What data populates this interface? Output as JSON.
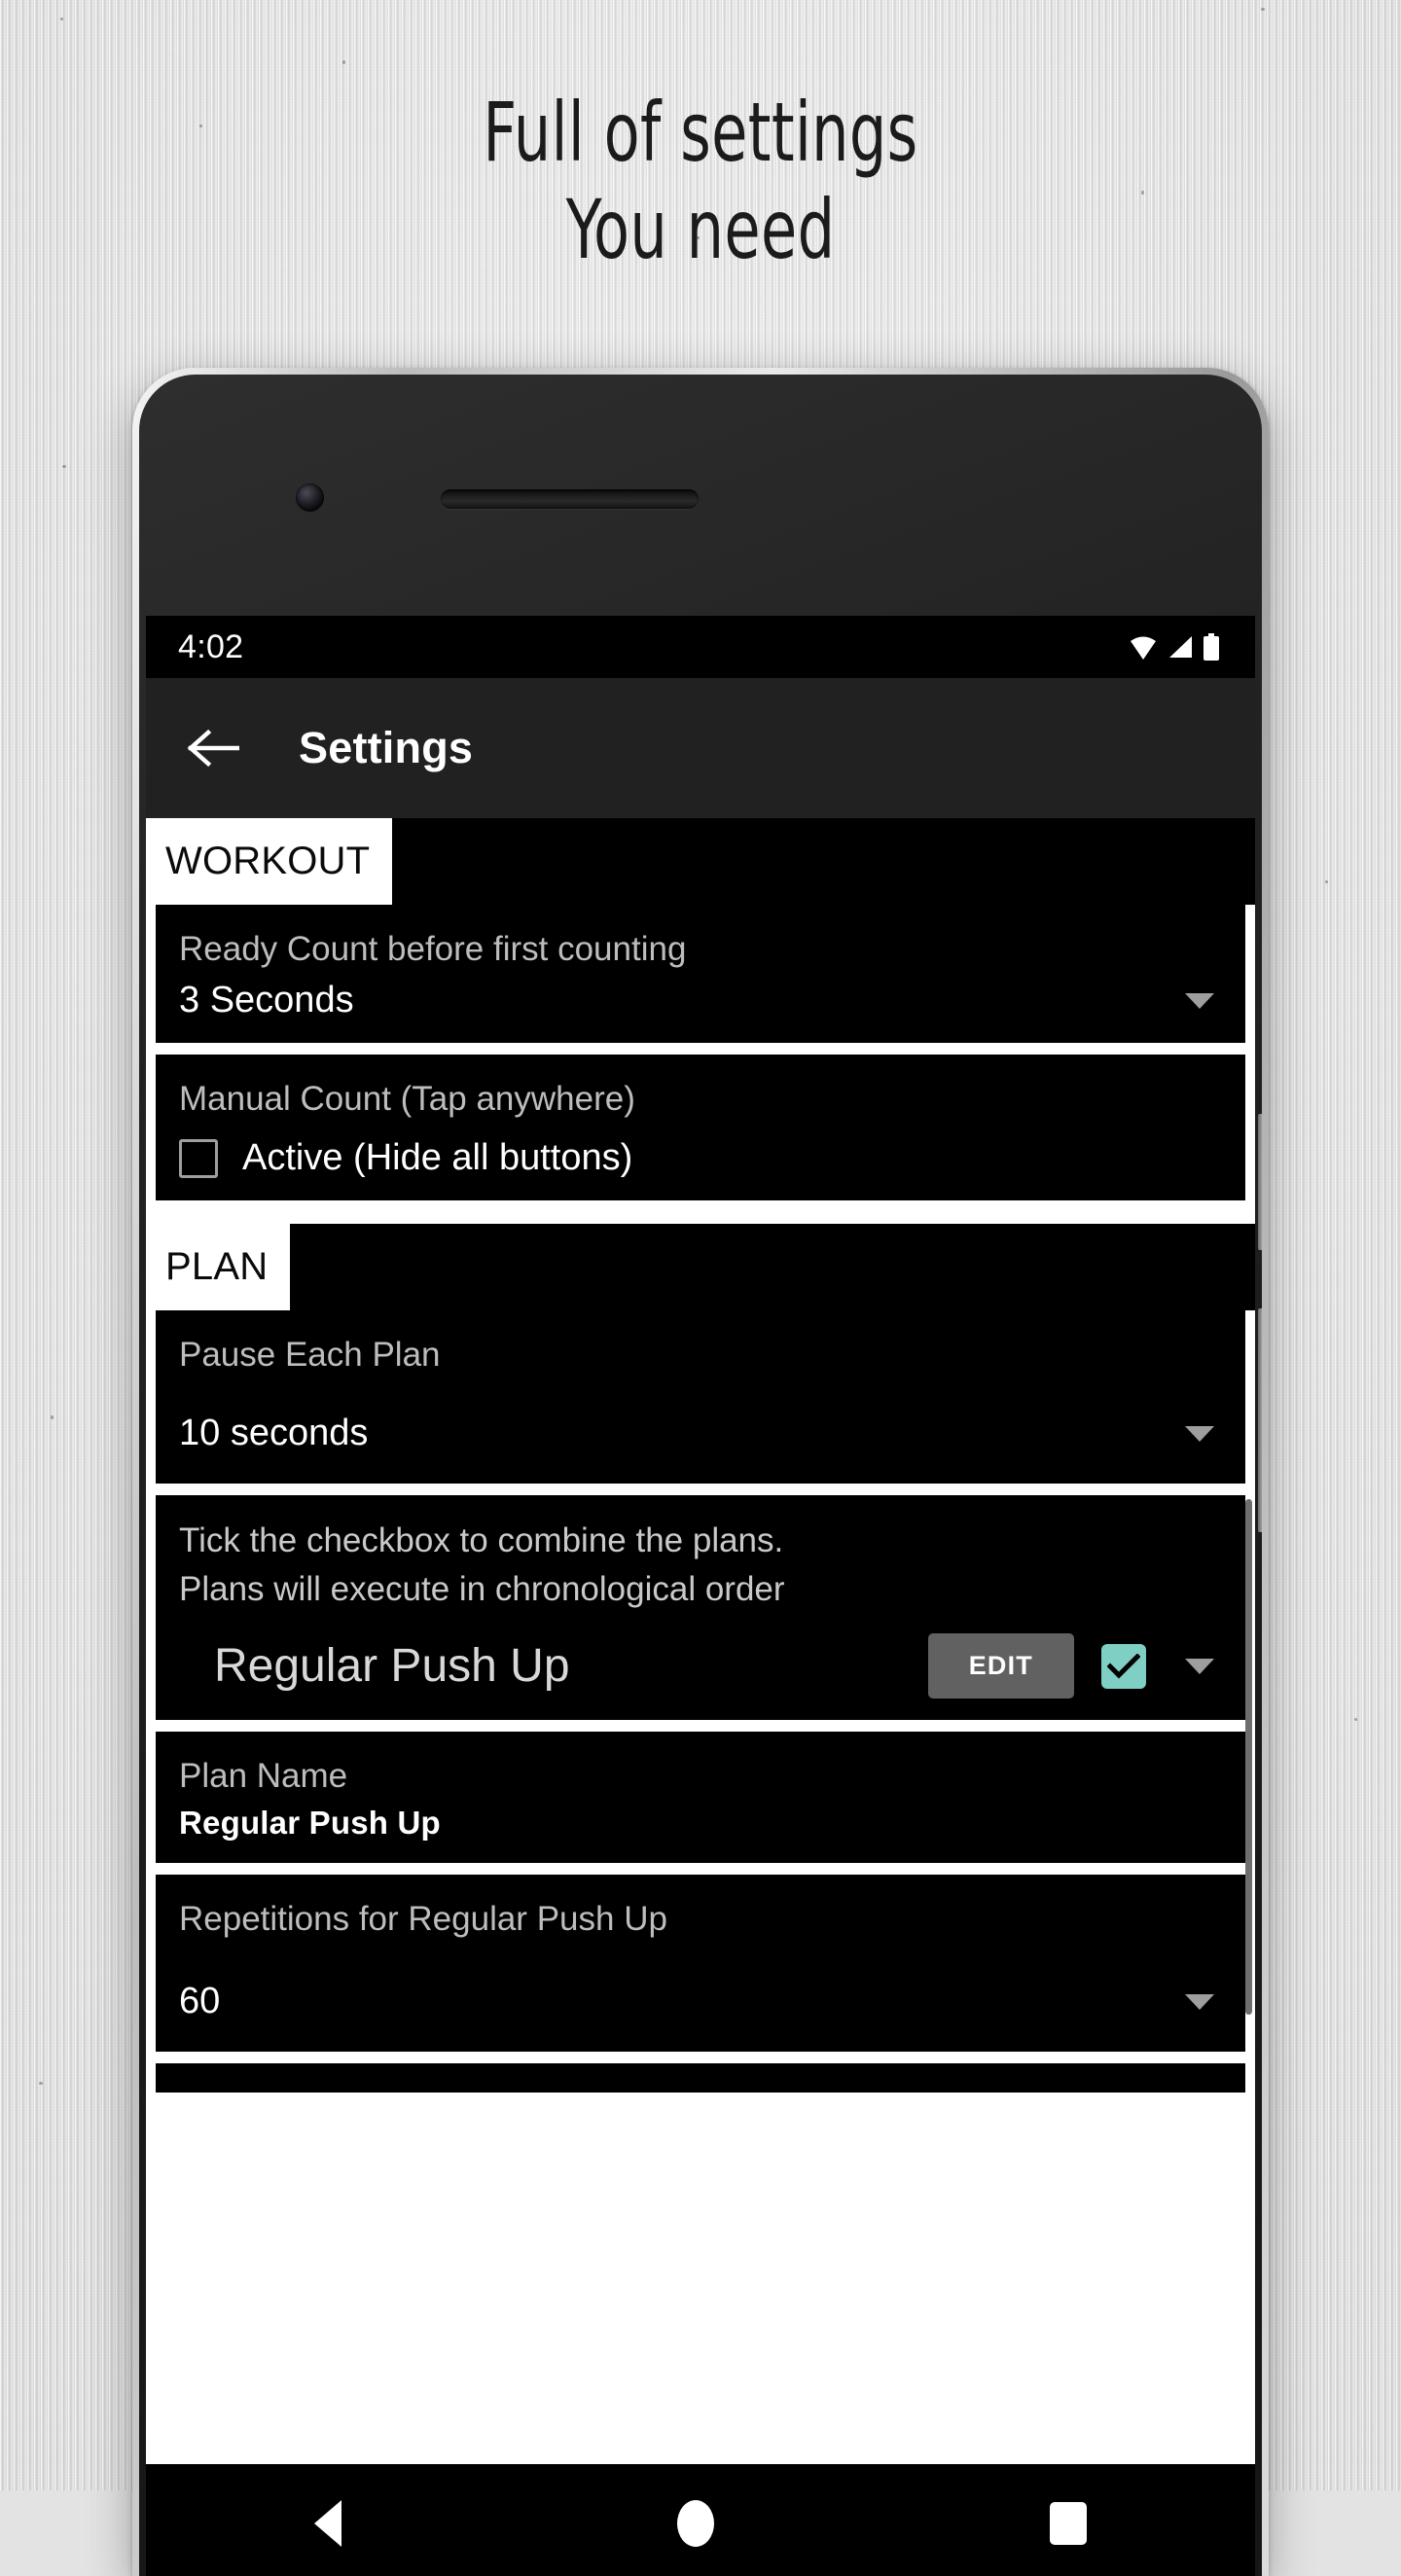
{
  "promo": {
    "headline_line1": "Full of settings",
    "headline_line2": "You need"
  },
  "phone": {
    "status_bar": {
      "time": "4:02",
      "icons": [
        "wifi-icon",
        "signal-icon",
        "battery-icon"
      ]
    },
    "app_bar": {
      "back_icon": "back-arrow-icon",
      "title": "Settings"
    },
    "nav_bar": {
      "back": "nav-back-icon",
      "home": "nav-home-icon",
      "recents": "nav-recents-icon"
    }
  },
  "colors": {
    "accent_teal": "#7FCFC4",
    "card_bg": "#000000",
    "app_bar_bg": "#212121",
    "label_gray": "#BDBDBD",
    "edit_button_bg": "#616161"
  },
  "sections": [
    {
      "tab_label": "WORKOUT",
      "cards": [
        {
          "type": "dropdown",
          "label": "Ready Count before first counting",
          "value": "3 Seconds"
        },
        {
          "type": "checkbox",
          "label": "Manual Count (Tap anywhere)",
          "checkbox_label": "Active (Hide all buttons)",
          "checked": false
        }
      ]
    },
    {
      "tab_label": "PLAN",
      "cards": [
        {
          "type": "dropdown",
          "label": "Pause Each Plan",
          "value": "10 seconds"
        },
        {
          "type": "plan",
          "hint_line1": "Tick the checkbox to combine the plans.",
          "hint_line2": "Plans will execute in chronological order",
          "plan_name": "Regular Push Up",
          "edit_label": "EDIT",
          "checked": true
        },
        {
          "type": "text",
          "label": "Plan Name",
          "value": "Regular Push Up"
        },
        {
          "type": "dropdown",
          "label": "Repetitions for Regular Push Up",
          "value": "60"
        }
      ]
    }
  ]
}
